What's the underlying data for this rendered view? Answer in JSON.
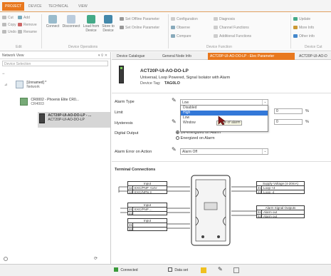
{
  "ribbon_tabs": [
    "PROJECT",
    "DEVICE",
    "TECHNICAL",
    "VIEW"
  ],
  "ribbon": {
    "edit": {
      "items": [
        "Cut",
        "Copy",
        "Undo",
        "Add",
        "Remove",
        "Rename"
      ],
      "group_label": "Edit"
    },
    "device_ops": {
      "connect": "Connect",
      "disconnect": "Disconnect",
      "load": "Load from Device",
      "store": "Store to Device",
      "group_label": "Device Operations"
    },
    "params": {
      "set_offline": "Set Offline Parameter",
      "set_online": "Set Online Parameter"
    },
    "functions": {
      "configuration": "Configuration",
      "diagnosis": "Diagnosis",
      "observe": "Observe",
      "channel_functions": "Channel Functions",
      "compare": "Compare",
      "additional_functions": "Additional Functions",
      "group_label": "Device Function"
    },
    "right": {
      "update": "Update",
      "more": "More Info",
      "info": "Other info",
      "group_label": "Device Cat"
    }
  },
  "left_panel": {
    "title": "Network View",
    "controls": "▾ ⚲ ✕",
    "search_placeholder": "Device Selection",
    "tree": [
      {
        "line1": "[Unnamed] *",
        "line2": "Network"
      },
      {
        "line1": "CR0002 - Phoenix Elite CR0...",
        "line2": "CR4003"
      },
      {
        "line1": "ACT20P-UI-AO-DO-LP - ...",
        "line2": "ACT20P-UI-AO-DO-LP"
      }
    ]
  },
  "doc_tabs": [
    "Device Catalogue",
    "General Node Info",
    "ACT20P-UI-AO-DO-LP - Elec Parameter",
    "ACT20P-UI-AO-D"
  ],
  "device": {
    "name": "ACT20P-UI-AO-DO-LP",
    "description": "Universal, Loop Powered, Signal Isolator with Alarm",
    "tag_label": "Device Tag:",
    "tag_value": "TAG0LO"
  },
  "form": {
    "alarm_type_label": "Alarm Type",
    "alarm_type_value": "Low",
    "limit_label": "Limit",
    "limit_value": "0",
    "hysteresis_label": "Hysteresis",
    "hysteresis_value": "0",
    "unit1": "%",
    "unit2": "%",
    "digital_output_label": "Digital Output",
    "de_energized": "De-energized on Alarm",
    "energized": "Energized on Alarm",
    "alarm_error_label": "Alarm Error on Action",
    "alarm_error_value": "Alarm Off"
  },
  "dropdown": {
    "options": [
      "Disabled",
      "High",
      "Low",
      "Window"
    ],
    "highlighted": 1,
    "tooltip": "Type of alarm"
  },
  "diagram": {
    "title": "Terminal Connections",
    "input_box1": {
      "header": "Input",
      "rows": [
        {
          "n": "11",
          "v": "EXC/PNP +14V"
        },
        {
          "n": "12",
          "v": "EXC/NPN 3"
        }
      ]
    },
    "input_box2": {
      "header": "Input",
      "rows": [
        {
          "n": "21",
          "v": "EXC/PNP ..."
        },
        {
          "n": "22",
          "v": ""
        }
      ]
    },
    "input_box3": {
      "header": "Input",
      "rows": [
        {
          "n": "31",
          "v": ""
        },
        {
          "n": "32",
          "v": ""
        }
      ]
    },
    "supply_box": {
      "header": "Supply Voltage (4-20mA)",
      "rows": [
        {
          "n": "41",
          "v": "Loop +4"
        },
        {
          "n": "42",
          "v": "Loop -4"
        }
      ]
    },
    "alarm_box": {
      "header": "Alarm Signal Outputs",
      "rows": [
        {
          "n": "51",
          "v": "Alarm out"
        },
        {
          "n": "52",
          "v": "Alarm out"
        }
      ]
    }
  },
  "status_bar": {
    "connected": "Connected",
    "data_set": "Data set"
  },
  "colors": {
    "accent": "#e8781e",
    "highlight": "#3378d8"
  }
}
